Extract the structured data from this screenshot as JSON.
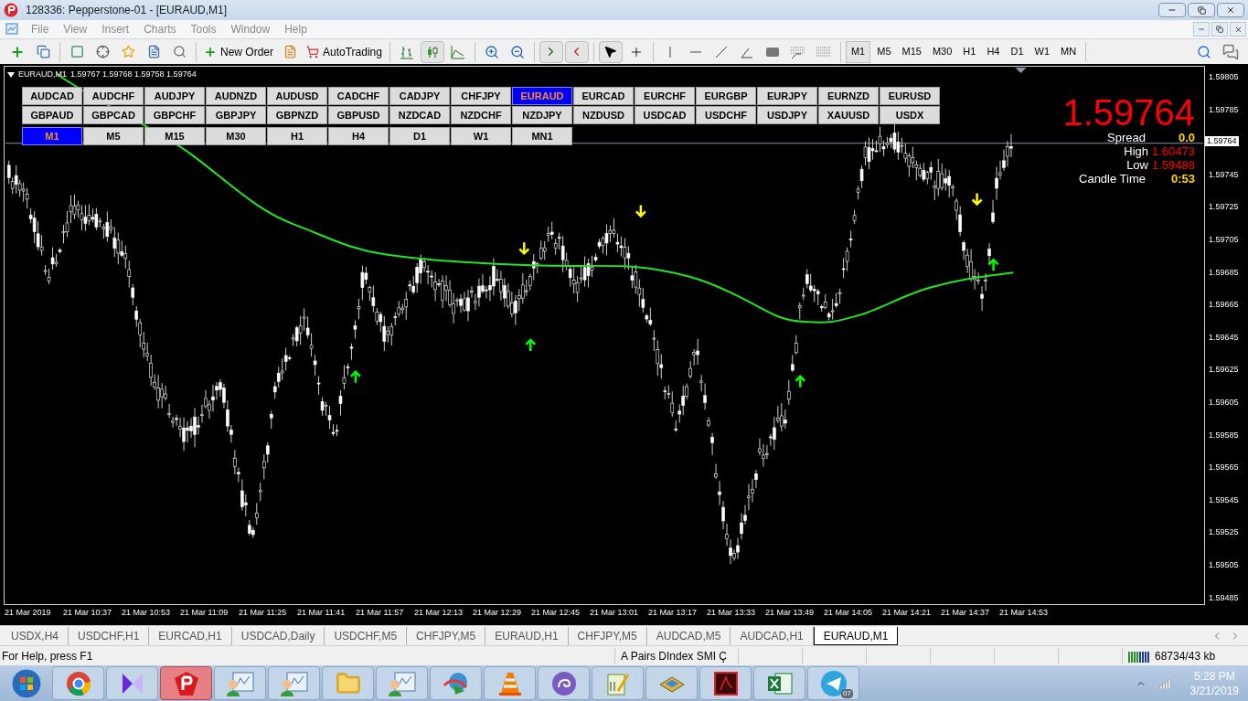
{
  "window": {
    "title": "128336: Pepperstone-01 - [EURAUD,M1]"
  },
  "menu": [
    {
      "label": "File",
      "disabled": true
    },
    {
      "label": "View",
      "disabled": true
    },
    {
      "label": "Insert",
      "disabled": true
    },
    {
      "label": "Charts",
      "disabled": true
    },
    {
      "label": "Tools",
      "disabled": true
    },
    {
      "label": "Window",
      "disabled": true
    },
    {
      "label": "Help",
      "disabled": true
    }
  ],
  "toolbar": {
    "new_order": "New Order",
    "auto_trading": "AutoTrading",
    "timeframes": [
      {
        "label": "M1",
        "selected": true
      },
      {
        "label": "M5",
        "selected": false
      },
      {
        "label": "M15",
        "selected": false
      },
      {
        "label": "M30",
        "selected": false
      },
      {
        "label": "H1",
        "selected": false
      },
      {
        "label": "H4",
        "selected": false
      },
      {
        "label": "D1",
        "selected": false
      },
      {
        "label": "W1",
        "selected": false
      },
      {
        "label": "MN",
        "selected": false
      }
    ]
  },
  "chart": {
    "header": {
      "symbol": "EURAUD,M1",
      "prices": "1.59767 1.59768 1.59758 1.59764"
    },
    "symbol_buttons": [
      {
        "label": "AUDCAD",
        "selected": false
      },
      {
        "label": "AUDCHF",
        "selected": false
      },
      {
        "label": "AUDJPY",
        "selected": false
      },
      {
        "label": "AUDNZD",
        "selected": false
      },
      {
        "label": "AUDUSD",
        "selected": false
      },
      {
        "label": "CADCHF",
        "selected": false
      },
      {
        "label": "CADJPY",
        "selected": false
      },
      {
        "label": "CHFJPY",
        "selected": false
      },
      {
        "label": "EURAUD",
        "selected": true
      },
      {
        "label": "EURCAD",
        "selected": false
      },
      {
        "label": "EURCHF",
        "selected": false
      },
      {
        "label": "EURGBP",
        "selected": false
      },
      {
        "label": "EURJPY",
        "selected": false
      },
      {
        "label": "EURNZD",
        "selected": false
      },
      {
        "label": "EURUSD",
        "selected": false
      },
      {
        "label": "GBPAUD",
        "selected": false
      },
      {
        "label": "GBPCAD",
        "selected": false
      },
      {
        "label": "GBPCHF",
        "selected": false
      },
      {
        "label": "GBPJPY",
        "selected": false
      },
      {
        "label": "GBPNZD",
        "selected": false
      },
      {
        "label": "GBPUSD",
        "selected": false
      },
      {
        "label": "NZDCAD",
        "selected": false
      },
      {
        "label": "NZDCHF",
        "selected": false
      },
      {
        "label": "NZDJPY",
        "selected": false
      },
      {
        "label": "NZDUSD",
        "selected": false
      },
      {
        "label": "USDCAD",
        "selected": false
      },
      {
        "label": "USDCHF",
        "selected": false
      },
      {
        "label": "USDJPY",
        "selected": false
      },
      {
        "label": "XAUUSD",
        "selected": false
      },
      {
        "label": "USDX",
        "selected": false
      }
    ],
    "timeframe_buttons": [
      {
        "label": "M1",
        "selected": true
      },
      {
        "label": "M5",
        "selected": false
      },
      {
        "label": "M15",
        "selected": false
      },
      {
        "label": "M30",
        "selected": false
      },
      {
        "label": "H1",
        "selected": false
      },
      {
        "label": "H4",
        "selected": false
      },
      {
        "label": "D1",
        "selected": false
      },
      {
        "label": "W1",
        "selected": false
      },
      {
        "label": "MN1",
        "selected": false
      }
    ],
    "info": {
      "price": "1.59764",
      "rows": [
        {
          "label": "Spread",
          "value": "0.0",
          "color": "#ffd700"
        },
        {
          "label": "High",
          "value": "1.60473",
          "color": "#ff0000"
        },
        {
          "label": "Low",
          "value": "1.59488",
          "color": "#ff0000"
        },
        {
          "label": "Candle Time",
          "value": "0:53",
          "color": "#ffd700"
        }
      ]
    },
    "current_price": "1.59764",
    "price_axis": [
      "1.59805",
      "1.59785",
      "1.59745",
      "1.59725",
      "1.59705",
      "1.59685",
      "1.59665",
      "1.59645",
      "1.59625",
      "1.59605",
      "1.59585",
      "1.59565",
      "1.59545",
      "1.59525",
      "1.59505",
      "1.59485"
    ],
    "time_axis": [
      "21 Mar 2019",
      "21 Mar 10:37",
      "21 Mar 10:53",
      "21 Mar 11:09",
      "21 Mar 11:25",
      "21 Mar 11:41",
      "21 Mar 11:57",
      "21 Mar 12:13",
      "21 Mar 12:29",
      "21 Mar 12:45",
      "21 Mar 13:01",
      "21 Mar 13:17",
      "21 Mar 13:33",
      "21 Mar 13:49",
      "21 Mar 14:05",
      "21 Mar 14:21",
      "21 Mar 14:37",
      "21 Mar 14:53"
    ]
  },
  "tabs": [
    {
      "label": "USDX,H4",
      "selected": false
    },
    {
      "label": "USDCHF,H1",
      "selected": false
    },
    {
      "label": "EURCAD,H1",
      "selected": false
    },
    {
      "label": "USDCAD,Daily",
      "selected": false
    },
    {
      "label": "USDCHF,M5",
      "selected": false
    },
    {
      "label": "CHFJPY,M5",
      "selected": false
    },
    {
      "label": "EURAUD,H1",
      "selected": false
    },
    {
      "label": "CHFJPY,M5",
      "selected": false
    },
    {
      "label": "AUDCAD,M5",
      "selected": false
    },
    {
      "label": "AUDCAD,H1",
      "selected": false
    },
    {
      "label": "EURAUD,M1",
      "selected": true
    }
  ],
  "status_bar": {
    "help": "For Help, press F1",
    "profile": "A Pairs DIndex SMI Ç",
    "connection": "68734/43 kb"
  },
  "taskbar": {
    "telegram_badge": "07",
    "time": "5:28 PM",
    "date": "3/21/2019"
  }
}
